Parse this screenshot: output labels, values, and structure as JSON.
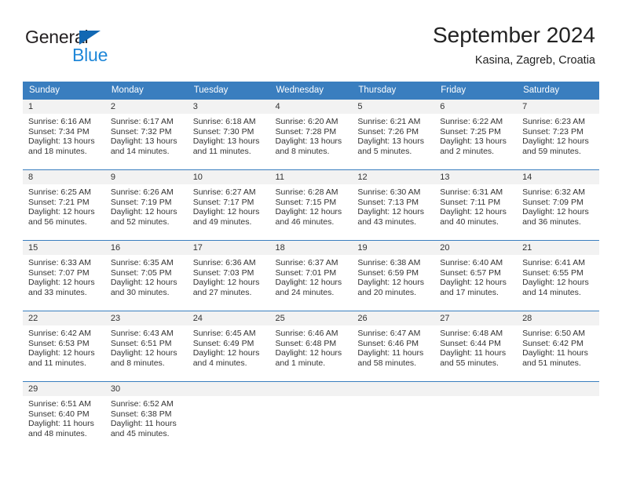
{
  "brand": {
    "name_part1": "General",
    "name_part2": "Blue",
    "triangle_color": "#1268b3",
    "blue_color": "#1f87d8"
  },
  "header": {
    "title": "September 2024",
    "subtitle": "Kasina, Zagreb, Croatia"
  },
  "colors": {
    "header_blue": "#3a7ebf",
    "daynum_band": "#f2f2f2",
    "text": "#333333"
  },
  "weekdays": [
    "Sunday",
    "Monday",
    "Tuesday",
    "Wednesday",
    "Thursday",
    "Friday",
    "Saturday"
  ],
  "weeks": [
    [
      {
        "day": "1",
        "sunrise": "Sunrise: 6:16 AM",
        "sunset": "Sunset: 7:34 PM",
        "daylight_line1": "Daylight: 13 hours",
        "daylight_line2": "and 18 minutes."
      },
      {
        "day": "2",
        "sunrise": "Sunrise: 6:17 AM",
        "sunset": "Sunset: 7:32 PM",
        "daylight_line1": "Daylight: 13 hours",
        "daylight_line2": "and 14 minutes."
      },
      {
        "day": "3",
        "sunrise": "Sunrise: 6:18 AM",
        "sunset": "Sunset: 7:30 PM",
        "daylight_line1": "Daylight: 13 hours",
        "daylight_line2": "and 11 minutes."
      },
      {
        "day": "4",
        "sunrise": "Sunrise: 6:20 AM",
        "sunset": "Sunset: 7:28 PM",
        "daylight_line1": "Daylight: 13 hours",
        "daylight_line2": "and 8 minutes."
      },
      {
        "day": "5",
        "sunrise": "Sunrise: 6:21 AM",
        "sunset": "Sunset: 7:26 PM",
        "daylight_line1": "Daylight: 13 hours",
        "daylight_line2": "and 5 minutes."
      },
      {
        "day": "6",
        "sunrise": "Sunrise: 6:22 AM",
        "sunset": "Sunset: 7:25 PM",
        "daylight_line1": "Daylight: 13 hours",
        "daylight_line2": "and 2 minutes."
      },
      {
        "day": "7",
        "sunrise": "Sunrise: 6:23 AM",
        "sunset": "Sunset: 7:23 PM",
        "daylight_line1": "Daylight: 12 hours",
        "daylight_line2": "and 59 minutes."
      }
    ],
    [
      {
        "day": "8",
        "sunrise": "Sunrise: 6:25 AM",
        "sunset": "Sunset: 7:21 PM",
        "daylight_line1": "Daylight: 12 hours",
        "daylight_line2": "and 56 minutes."
      },
      {
        "day": "9",
        "sunrise": "Sunrise: 6:26 AM",
        "sunset": "Sunset: 7:19 PM",
        "daylight_line1": "Daylight: 12 hours",
        "daylight_line2": "and 52 minutes."
      },
      {
        "day": "10",
        "sunrise": "Sunrise: 6:27 AM",
        "sunset": "Sunset: 7:17 PM",
        "daylight_line1": "Daylight: 12 hours",
        "daylight_line2": "and 49 minutes."
      },
      {
        "day": "11",
        "sunrise": "Sunrise: 6:28 AM",
        "sunset": "Sunset: 7:15 PM",
        "daylight_line1": "Daylight: 12 hours",
        "daylight_line2": "and 46 minutes."
      },
      {
        "day": "12",
        "sunrise": "Sunrise: 6:30 AM",
        "sunset": "Sunset: 7:13 PM",
        "daylight_line1": "Daylight: 12 hours",
        "daylight_line2": "and 43 minutes."
      },
      {
        "day": "13",
        "sunrise": "Sunrise: 6:31 AM",
        "sunset": "Sunset: 7:11 PM",
        "daylight_line1": "Daylight: 12 hours",
        "daylight_line2": "and 40 minutes."
      },
      {
        "day": "14",
        "sunrise": "Sunrise: 6:32 AM",
        "sunset": "Sunset: 7:09 PM",
        "daylight_line1": "Daylight: 12 hours",
        "daylight_line2": "and 36 minutes."
      }
    ],
    [
      {
        "day": "15",
        "sunrise": "Sunrise: 6:33 AM",
        "sunset": "Sunset: 7:07 PM",
        "daylight_line1": "Daylight: 12 hours",
        "daylight_line2": "and 33 minutes."
      },
      {
        "day": "16",
        "sunrise": "Sunrise: 6:35 AM",
        "sunset": "Sunset: 7:05 PM",
        "daylight_line1": "Daylight: 12 hours",
        "daylight_line2": "and 30 minutes."
      },
      {
        "day": "17",
        "sunrise": "Sunrise: 6:36 AM",
        "sunset": "Sunset: 7:03 PM",
        "daylight_line1": "Daylight: 12 hours",
        "daylight_line2": "and 27 minutes."
      },
      {
        "day": "18",
        "sunrise": "Sunrise: 6:37 AM",
        "sunset": "Sunset: 7:01 PM",
        "daylight_line1": "Daylight: 12 hours",
        "daylight_line2": "and 24 minutes."
      },
      {
        "day": "19",
        "sunrise": "Sunrise: 6:38 AM",
        "sunset": "Sunset: 6:59 PM",
        "daylight_line1": "Daylight: 12 hours",
        "daylight_line2": "and 20 minutes."
      },
      {
        "day": "20",
        "sunrise": "Sunrise: 6:40 AM",
        "sunset": "Sunset: 6:57 PM",
        "daylight_line1": "Daylight: 12 hours",
        "daylight_line2": "and 17 minutes."
      },
      {
        "day": "21",
        "sunrise": "Sunrise: 6:41 AM",
        "sunset": "Sunset: 6:55 PM",
        "daylight_line1": "Daylight: 12 hours",
        "daylight_line2": "and 14 minutes."
      }
    ],
    [
      {
        "day": "22",
        "sunrise": "Sunrise: 6:42 AM",
        "sunset": "Sunset: 6:53 PM",
        "daylight_line1": "Daylight: 12 hours",
        "daylight_line2": "and 11 minutes."
      },
      {
        "day": "23",
        "sunrise": "Sunrise: 6:43 AM",
        "sunset": "Sunset: 6:51 PM",
        "daylight_line1": "Daylight: 12 hours",
        "daylight_line2": "and 8 minutes."
      },
      {
        "day": "24",
        "sunrise": "Sunrise: 6:45 AM",
        "sunset": "Sunset: 6:49 PM",
        "daylight_line1": "Daylight: 12 hours",
        "daylight_line2": "and 4 minutes."
      },
      {
        "day": "25",
        "sunrise": "Sunrise: 6:46 AM",
        "sunset": "Sunset: 6:48 PM",
        "daylight_line1": "Daylight: 12 hours",
        "daylight_line2": "and 1 minute."
      },
      {
        "day": "26",
        "sunrise": "Sunrise: 6:47 AM",
        "sunset": "Sunset: 6:46 PM",
        "daylight_line1": "Daylight: 11 hours",
        "daylight_line2": "and 58 minutes."
      },
      {
        "day": "27",
        "sunrise": "Sunrise: 6:48 AM",
        "sunset": "Sunset: 6:44 PM",
        "daylight_line1": "Daylight: 11 hours",
        "daylight_line2": "and 55 minutes."
      },
      {
        "day": "28",
        "sunrise": "Sunrise: 6:50 AM",
        "sunset": "Sunset: 6:42 PM",
        "daylight_line1": "Daylight: 11 hours",
        "daylight_line2": "and 51 minutes."
      }
    ],
    [
      {
        "day": "29",
        "sunrise": "Sunrise: 6:51 AM",
        "sunset": "Sunset: 6:40 PM",
        "daylight_line1": "Daylight: 11 hours",
        "daylight_line2": "and 48 minutes."
      },
      {
        "day": "30",
        "sunrise": "Sunrise: 6:52 AM",
        "sunset": "Sunset: 6:38 PM",
        "daylight_line1": "Daylight: 11 hours",
        "daylight_line2": "and 45 minutes."
      },
      {
        "day": "",
        "sunrise": "",
        "sunset": "",
        "daylight_line1": "",
        "daylight_line2": ""
      },
      {
        "day": "",
        "sunrise": "",
        "sunset": "",
        "daylight_line1": "",
        "daylight_line2": ""
      },
      {
        "day": "",
        "sunrise": "",
        "sunset": "",
        "daylight_line1": "",
        "daylight_line2": ""
      },
      {
        "day": "",
        "sunrise": "",
        "sunset": "",
        "daylight_line1": "",
        "daylight_line2": ""
      },
      {
        "day": "",
        "sunrise": "",
        "sunset": "",
        "daylight_line1": "",
        "daylight_line2": ""
      }
    ]
  ]
}
